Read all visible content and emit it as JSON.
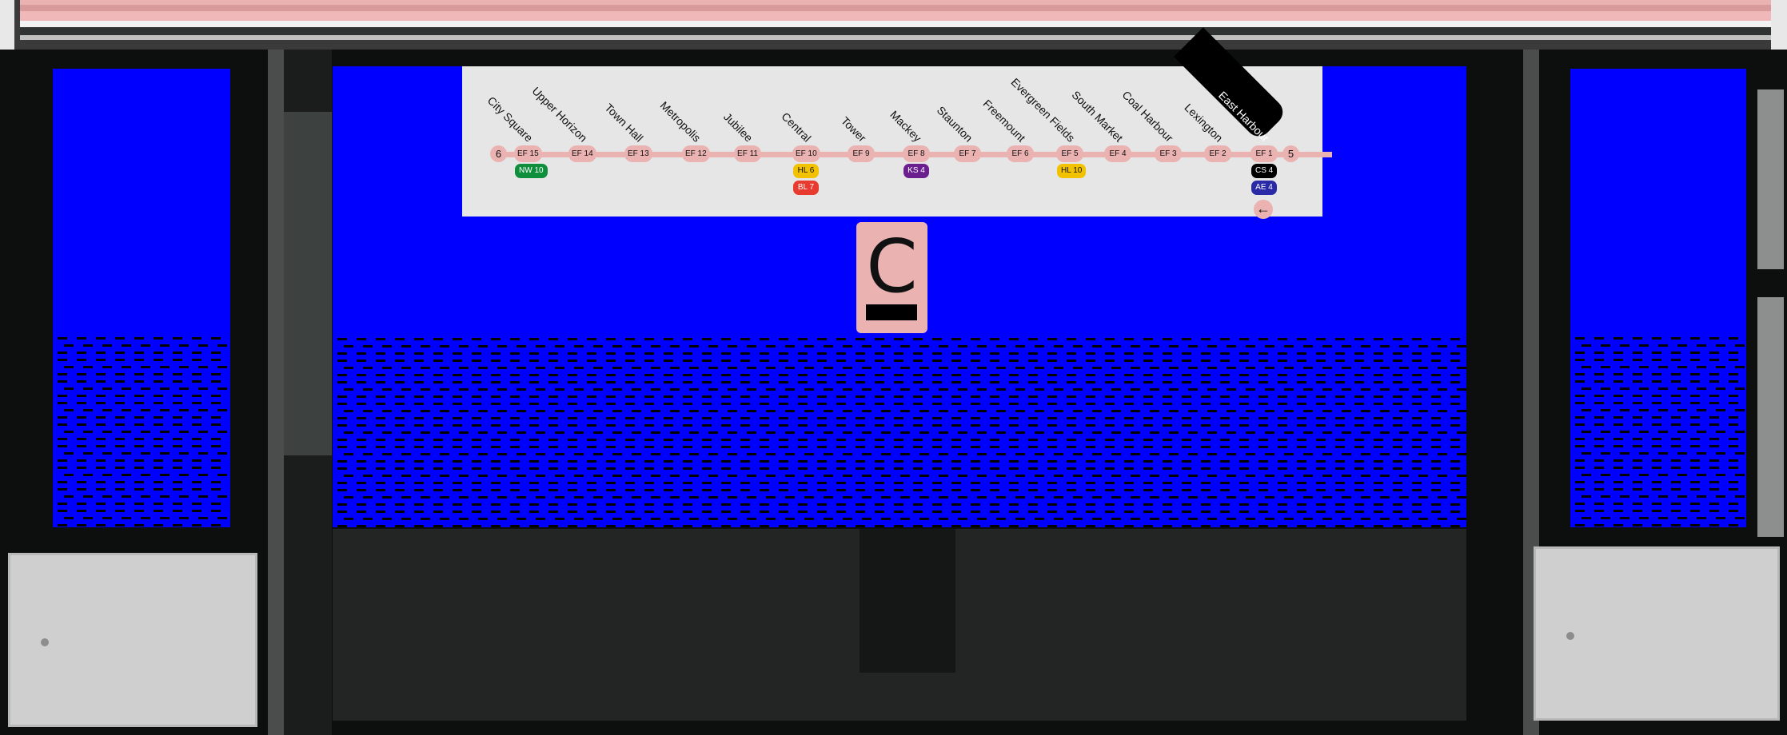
{
  "display": {
    "end_left": "6",
    "end_right": "5",
    "route_letter": "C",
    "current_station": "East Harbour",
    "direction_arrow": "←"
  },
  "stations": [
    {
      "name": "City Square",
      "code": "EF 15",
      "transfers": [
        {
          "label": "NW 10",
          "color": "#0f8f3c",
          "text": "#ffffff"
        }
      ]
    },
    {
      "name": "Upper Horizon",
      "code": "EF 14",
      "transfers": []
    },
    {
      "name": "Town Hall",
      "code": "EF 13",
      "transfers": []
    },
    {
      "name": "Metropolis",
      "code": "EF 12",
      "transfers": []
    },
    {
      "name": "Jubilee",
      "code": "EF 11",
      "transfers": []
    },
    {
      "name": "Central",
      "code": "EF 10",
      "transfers": [
        {
          "label": "HL 6",
          "color": "#f2c200",
          "text": "#111111"
        },
        {
          "label": "BL 7",
          "color": "#e83a2e",
          "text": "#ffffff"
        }
      ]
    },
    {
      "name": "Tower",
      "code": "EF 9",
      "transfers": []
    },
    {
      "name": "Mackey",
      "code": "EF 8",
      "transfers": [
        {
          "label": "KS 4",
          "color": "#6b1f8f",
          "text": "#ffffff"
        }
      ]
    },
    {
      "name": "Staunton",
      "code": "EF 7",
      "transfers": []
    },
    {
      "name": "Freemount",
      "code": "EF 6",
      "transfers": []
    },
    {
      "name": "Evergreen Fields",
      "code": "EF 5",
      "transfers": [
        {
          "label": "HL 10",
          "color": "#f2c200",
          "text": "#111111"
        }
      ]
    },
    {
      "name": "South Market",
      "code": "EF 4",
      "transfers": []
    },
    {
      "name": "Coal Harbour",
      "code": "EF 3",
      "transfers": []
    },
    {
      "name": "Lexington",
      "code": "EF 2",
      "transfers": []
    },
    {
      "name": "East Harbour",
      "code": "EF 1",
      "transfers": [
        {
          "label": "CS 4",
          "color": "#000000",
          "text": "#ffffff"
        },
        {
          "label": "AE 4",
          "color": "#2a2aa8",
          "text": "#ffffff"
        }
      ],
      "current": true
    }
  ],
  "colors": {
    "line": "#ebb2b2",
    "led_panel": "#0000ff",
    "map_bg": "#e6e6e6",
    "grey_panel": "#cfcfcf"
  }
}
